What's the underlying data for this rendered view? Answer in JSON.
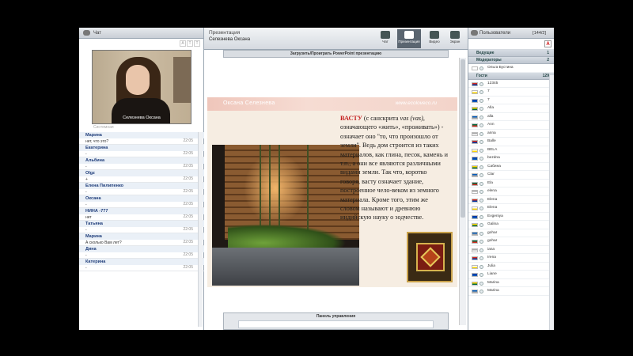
{
  "chat": {
    "header": "Чат",
    "font_buttons": [
      "A",
      "T",
      "T"
    ],
    "video_caption": "Селезнева Оксана",
    "system_label": "Системная",
    "messages": [
      {
        "name": "Марина",
        "text": "нет, что это?",
        "time": "22:05"
      },
      {
        "name": "Екатерина",
        "text": "-",
        "time": "22:05"
      },
      {
        "name": "Альбина",
        "text": "-",
        "time": "22:05"
      },
      {
        "name": "Olgz",
        "text": "+",
        "time": "22:05"
      },
      {
        "name": "Елена Пилипенко",
        "text": "-",
        "time": "22:05"
      },
      {
        "name": "Оксана",
        "text": "-",
        "time": "22:05"
      },
      {
        "name": "НИНА -777",
        "text": "нет",
        "time": "22:05"
      },
      {
        "name": "Татьяна",
        "text": "-",
        "time": "22:05"
      },
      {
        "name": "Марина",
        "text": "А сколько Вам лет?",
        "time": "22:05"
      },
      {
        "name": "Дина",
        "text": "-",
        "time": "22:05"
      },
      {
        "name": "Катерина",
        "text": "-",
        "time": "22:05"
      }
    ]
  },
  "presentation": {
    "header_title": "Презентация",
    "header_subtitle": "Селезнева Оксана",
    "tabs": [
      {
        "label": "Чат",
        "icon": "chat-bubble-icon"
      },
      {
        "label": "Презентация",
        "icon": "presentation-board-icon",
        "active": true
      },
      {
        "label": "Видео",
        "icon": "video-camera-icon"
      },
      {
        "label": "Экран",
        "icon": "monitor-icon"
      }
    ],
    "upload_label": "Загрузить/Проиграть PowerPoint презентацию",
    "control_panel_label": "Панель управления"
  },
  "slide": {
    "author": "Оксана Селезнева",
    "url": "www.ecoloveco.ru",
    "keyword": "ВАСТУ",
    "text_1": " (с санскрита ",
    "text_italic": "vas (vas)",
    "text_2": ", означающего «жить», «проживать») - означает оно \"то, что произошло от земли\". Ведь дом строится из таких материалов, как глина, песок, камень и т.п., а они все являются различными видами земли. Так что, коротко говоря, васту означает здание, построенное чело-веком из земного материала. Кроме того, этим же словом называют и древнюю индийскую науку о зодчестве."
  },
  "users": {
    "header": "Пользователи",
    "count": "[144/2]",
    "font_button": "A",
    "groups": {
      "leading": {
        "label": "Ведущие",
        "count": "1"
      },
      "moderators": {
        "label": "Модераторы",
        "count": "2"
      },
      "guests": {
        "label": "Гости",
        "count": "129"
      }
    },
    "moderator_list": [
      "Ольга Бустина"
    ],
    "guest_list": [
      "12345",
      "7",
      "7",
      "Alla",
      "alla",
      "Ann",
      "anna",
      "Balle",
      "BELA",
      "bezdna",
      "Сабина",
      "Clar",
      "Ela",
      "elena",
      "Elena",
      "Elena",
      "Evgeniya",
      "Galina",
      "gohar",
      "gohar",
      "iana",
      "Irena",
      "Julia",
      "Liane",
      "Marina",
      "Marina"
    ],
    "flag_colors": [
      "#d52b1e",
      "#ffffff",
      "#0039a6",
      "#ffd500",
      "#005bbb",
      "#006b3f",
      "#aaaaaa"
    ]
  }
}
